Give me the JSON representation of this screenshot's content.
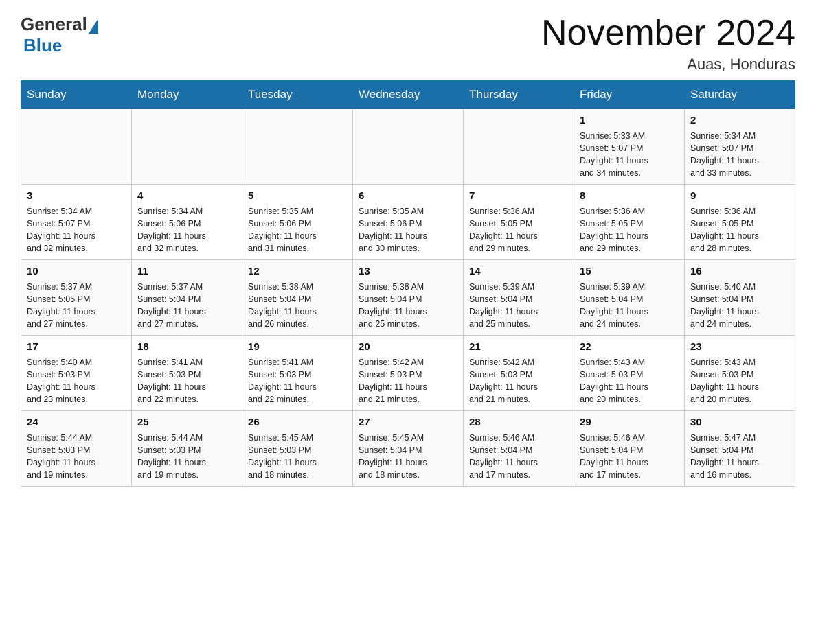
{
  "logo": {
    "general": "General",
    "blue": "Blue"
  },
  "title": {
    "month_year": "November 2024",
    "location": "Auas, Honduras"
  },
  "weekdays": [
    "Sunday",
    "Monday",
    "Tuesday",
    "Wednesday",
    "Thursday",
    "Friday",
    "Saturday"
  ],
  "weeks": [
    [
      {
        "day": "",
        "info": ""
      },
      {
        "day": "",
        "info": ""
      },
      {
        "day": "",
        "info": ""
      },
      {
        "day": "",
        "info": ""
      },
      {
        "day": "",
        "info": ""
      },
      {
        "day": "1",
        "info": "Sunrise: 5:33 AM\nSunset: 5:07 PM\nDaylight: 11 hours\nand 34 minutes."
      },
      {
        "day": "2",
        "info": "Sunrise: 5:34 AM\nSunset: 5:07 PM\nDaylight: 11 hours\nand 33 minutes."
      }
    ],
    [
      {
        "day": "3",
        "info": "Sunrise: 5:34 AM\nSunset: 5:07 PM\nDaylight: 11 hours\nand 32 minutes."
      },
      {
        "day": "4",
        "info": "Sunrise: 5:34 AM\nSunset: 5:06 PM\nDaylight: 11 hours\nand 32 minutes."
      },
      {
        "day": "5",
        "info": "Sunrise: 5:35 AM\nSunset: 5:06 PM\nDaylight: 11 hours\nand 31 minutes."
      },
      {
        "day": "6",
        "info": "Sunrise: 5:35 AM\nSunset: 5:06 PM\nDaylight: 11 hours\nand 30 minutes."
      },
      {
        "day": "7",
        "info": "Sunrise: 5:36 AM\nSunset: 5:05 PM\nDaylight: 11 hours\nand 29 minutes."
      },
      {
        "day": "8",
        "info": "Sunrise: 5:36 AM\nSunset: 5:05 PM\nDaylight: 11 hours\nand 29 minutes."
      },
      {
        "day": "9",
        "info": "Sunrise: 5:36 AM\nSunset: 5:05 PM\nDaylight: 11 hours\nand 28 minutes."
      }
    ],
    [
      {
        "day": "10",
        "info": "Sunrise: 5:37 AM\nSunset: 5:05 PM\nDaylight: 11 hours\nand 27 minutes."
      },
      {
        "day": "11",
        "info": "Sunrise: 5:37 AM\nSunset: 5:04 PM\nDaylight: 11 hours\nand 27 minutes."
      },
      {
        "day": "12",
        "info": "Sunrise: 5:38 AM\nSunset: 5:04 PM\nDaylight: 11 hours\nand 26 minutes."
      },
      {
        "day": "13",
        "info": "Sunrise: 5:38 AM\nSunset: 5:04 PM\nDaylight: 11 hours\nand 25 minutes."
      },
      {
        "day": "14",
        "info": "Sunrise: 5:39 AM\nSunset: 5:04 PM\nDaylight: 11 hours\nand 25 minutes."
      },
      {
        "day": "15",
        "info": "Sunrise: 5:39 AM\nSunset: 5:04 PM\nDaylight: 11 hours\nand 24 minutes."
      },
      {
        "day": "16",
        "info": "Sunrise: 5:40 AM\nSunset: 5:04 PM\nDaylight: 11 hours\nand 24 minutes."
      }
    ],
    [
      {
        "day": "17",
        "info": "Sunrise: 5:40 AM\nSunset: 5:03 PM\nDaylight: 11 hours\nand 23 minutes."
      },
      {
        "day": "18",
        "info": "Sunrise: 5:41 AM\nSunset: 5:03 PM\nDaylight: 11 hours\nand 22 minutes."
      },
      {
        "day": "19",
        "info": "Sunrise: 5:41 AM\nSunset: 5:03 PM\nDaylight: 11 hours\nand 22 minutes."
      },
      {
        "day": "20",
        "info": "Sunrise: 5:42 AM\nSunset: 5:03 PM\nDaylight: 11 hours\nand 21 minutes."
      },
      {
        "day": "21",
        "info": "Sunrise: 5:42 AM\nSunset: 5:03 PM\nDaylight: 11 hours\nand 21 minutes."
      },
      {
        "day": "22",
        "info": "Sunrise: 5:43 AM\nSunset: 5:03 PM\nDaylight: 11 hours\nand 20 minutes."
      },
      {
        "day": "23",
        "info": "Sunrise: 5:43 AM\nSunset: 5:03 PM\nDaylight: 11 hours\nand 20 minutes."
      }
    ],
    [
      {
        "day": "24",
        "info": "Sunrise: 5:44 AM\nSunset: 5:03 PM\nDaylight: 11 hours\nand 19 minutes."
      },
      {
        "day": "25",
        "info": "Sunrise: 5:44 AM\nSunset: 5:03 PM\nDaylight: 11 hours\nand 19 minutes."
      },
      {
        "day": "26",
        "info": "Sunrise: 5:45 AM\nSunset: 5:03 PM\nDaylight: 11 hours\nand 18 minutes."
      },
      {
        "day": "27",
        "info": "Sunrise: 5:45 AM\nSunset: 5:04 PM\nDaylight: 11 hours\nand 18 minutes."
      },
      {
        "day": "28",
        "info": "Sunrise: 5:46 AM\nSunset: 5:04 PM\nDaylight: 11 hours\nand 17 minutes."
      },
      {
        "day": "29",
        "info": "Sunrise: 5:46 AM\nSunset: 5:04 PM\nDaylight: 11 hours\nand 17 minutes."
      },
      {
        "day": "30",
        "info": "Sunrise: 5:47 AM\nSunset: 5:04 PM\nDaylight: 11 hours\nand 16 minutes."
      }
    ]
  ]
}
